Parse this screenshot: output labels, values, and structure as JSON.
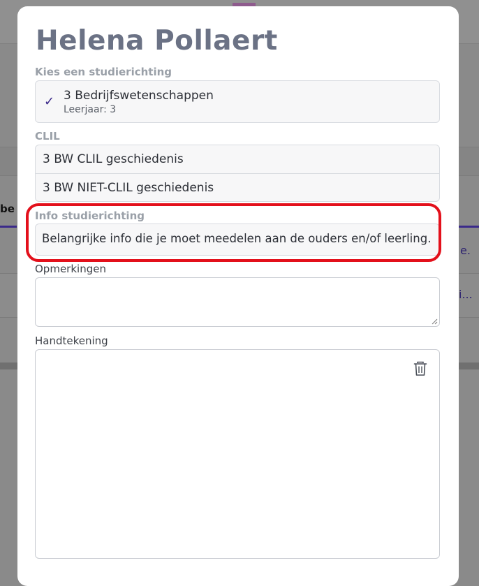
{
  "background": {
    "tab_fragment": "be",
    "row_fragment_1": "e.",
    "row_fragment_2": "i..."
  },
  "modal": {
    "title": "Helena Pollaert",
    "study": {
      "label": "Kies een studierichting",
      "selected_name": "3 Bedrijfswetenschappen",
      "selected_sub": "Leerjaar: 3",
      "check_icon": "check-icon"
    },
    "clil": {
      "label": "CLIL",
      "options": [
        "3 BW CLIL geschiedenis",
        "3 BW NIET-CLIL geschiedenis"
      ]
    },
    "info": {
      "label": "Info studierichting",
      "text": "Belangrijke info die je moet meedelen aan de ouders en/of leerling."
    },
    "remarks": {
      "label": "Opmerkingen",
      "value": ""
    },
    "signature": {
      "label": "Handtekening",
      "clear_icon": "trash-icon"
    }
  },
  "colors": {
    "accent": "#3b2a8a",
    "highlight": "#e3101b",
    "title": "#6b7285"
  }
}
